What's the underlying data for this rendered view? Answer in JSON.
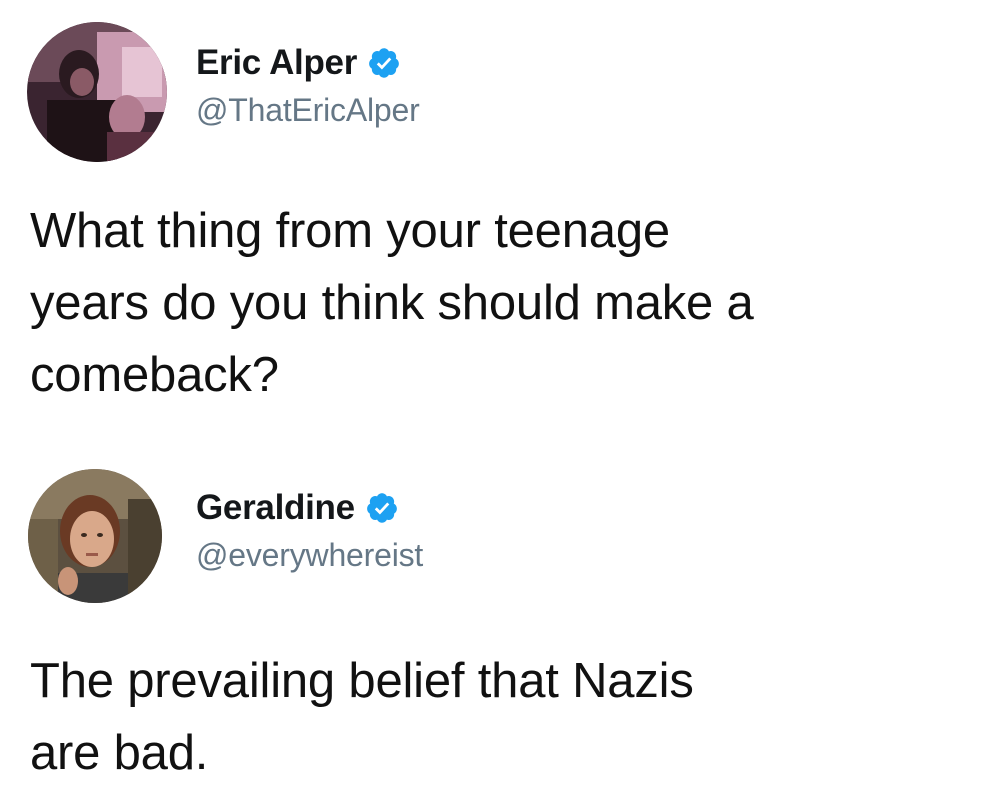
{
  "tweets": [
    {
      "author": {
        "display_name": "Eric Alper",
        "handle": "@ThatEricAlper",
        "verified": true,
        "avatar_icon": "profile-photo"
      },
      "text_lines": [
        "What thing from your teenage",
        "years do you think should make a",
        "comeback?"
      ]
    },
    {
      "author": {
        "display_name": "Geraldine",
        "handle": "@everywhereist",
        "verified": true,
        "avatar_icon": "profile-photo"
      },
      "text_lines": [
        "The prevailing belief that Nazis",
        "are bad."
      ]
    }
  ],
  "colors": {
    "verified_badge": "#1da1f2",
    "handle_text": "#657786",
    "name_text": "#14171a",
    "background": "#ffffff"
  }
}
